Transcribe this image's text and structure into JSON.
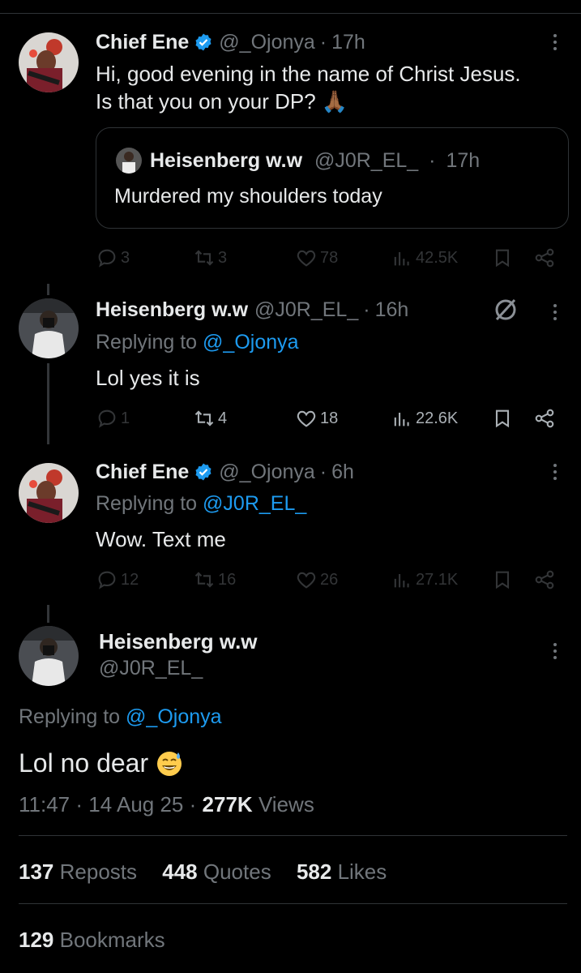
{
  "tweets": [
    {
      "name": "Chief Ene",
      "handle": "@_Ojonya",
      "sep": "·",
      "time": "17h",
      "text_lines": [
        "Hi, good evening in the name of Christ Jesus.",
        "Is that you on your DP? 🙏🏾"
      ],
      "quote": {
        "name": "Heisenberg w.w",
        "handle": "@J0R_EL_",
        "sep": "·",
        "time": "17h",
        "text": "Murdered my shoulders today"
      },
      "stats": {
        "replies": "3",
        "reposts": "3",
        "likes": "78",
        "views": "42.5K"
      }
    },
    {
      "name": "Heisenberg w.w",
      "handle": "@J0R_EL_",
      "sep": "·",
      "time": "16h",
      "replying_prefix": "Replying to",
      "replying_to": "@_Ojonya",
      "text": "Lol yes it is",
      "stats": {
        "replies": "1",
        "reposts": "4",
        "likes": "18",
        "views": "22.6K"
      }
    },
    {
      "name": "Chief Ene",
      "handle": "@_Ojonya",
      "sep": "·",
      "time": "6h",
      "replying_prefix": "Replying to",
      "replying_to": "@J0R_EL_",
      "text": "Wow. Text me",
      "stats": {
        "replies": "12",
        "reposts": "16",
        "likes": "26",
        "views": "27.1K"
      }
    }
  ],
  "main": {
    "name": "Heisenberg w.w",
    "handle": "@J0R_EL_",
    "replying_prefix": "Replying to",
    "replying_to": "@_Ojonya",
    "text": "Lol no dear",
    "time": "11:47",
    "sep1": "·",
    "date": "14 Aug 25",
    "sep2": "·",
    "views_count": "277K",
    "views_label": "Views",
    "reposts_count": "137",
    "reposts_label": "Reposts",
    "quotes_count": "448",
    "quotes_label": "Quotes",
    "likes_count": "582",
    "likes_label": "Likes",
    "bookmarks_count": "129",
    "bookmarks_label": "Bookmarks"
  },
  "icons": {
    "verified": "verified-badge-icon",
    "reply": "reply-icon",
    "repost": "repost-icon",
    "like": "heart-icon",
    "views": "views-icon",
    "bookmark": "bookmark-icon",
    "share": "share-icon",
    "more": "more-icon",
    "slash": "slash-circle-icon",
    "emoji": "sweat-smile-emoji"
  },
  "colors": {
    "link": "#1d9bf0",
    "muted": "#71767b",
    "text": "#e7e9ea",
    "bg": "#000000",
    "verified": "#1d9bf0"
  }
}
